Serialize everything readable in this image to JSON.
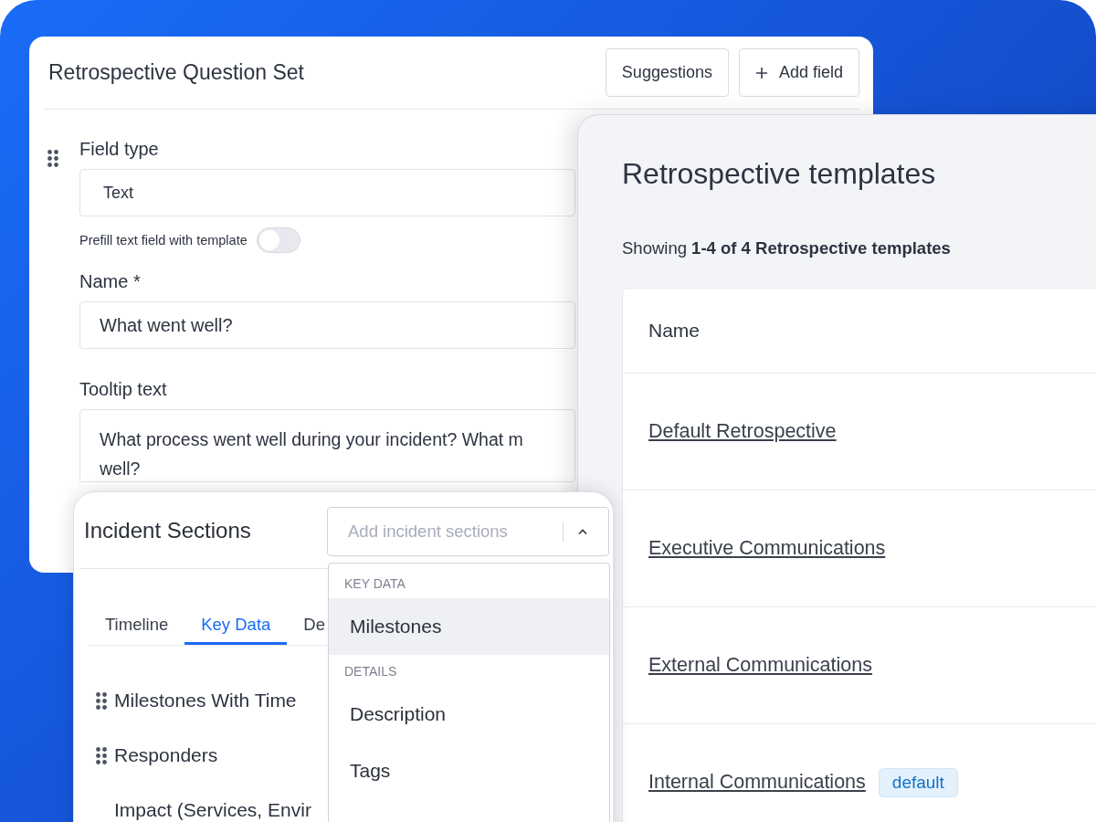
{
  "question_set": {
    "title": "Retrospective Question Set",
    "buttons": [
      {
        "label": "Suggestions",
        "kind": "plain"
      },
      {
        "label": "Add field",
        "kind": "add"
      }
    ],
    "field_type": {
      "label": "Field type",
      "value": "Text"
    },
    "prefill": {
      "label": "Prefill text field with template",
      "on": false
    },
    "name": {
      "label": "Name *",
      "value": "What went well?"
    },
    "tooltip": {
      "label": "Tooltip text",
      "lines": [
        "What process went well during your incident? What m",
        "well?"
      ]
    }
  },
  "templates": {
    "title": "Retrospective templates",
    "summary": "Showing **1-4 of 4 Retrospective templates**",
    "table": {
      "columns": [
        "Name"
      ],
      "rows": [
        {
          "name": "Default Retrospective"
        },
        {
          "name": "Executive Communications"
        },
        {
          "name": "External Communications"
        },
        {
          "name": "Internal Communications",
          "badge": "default"
        }
      ]
    }
  },
  "incident_sections": {
    "title": "Incident Sections",
    "select": {
      "placeholder": "Add incident sections",
      "expanded": true
    },
    "tabs": [
      {
        "label": "Timeline",
        "selected": false
      },
      {
        "label": "Key Data",
        "selected": true
      },
      {
        "label": "De",
        "selected": false
      }
    ],
    "sections": [
      {
        "label": "Milestones With Time",
        "draggable": true
      },
      {
        "label": "Responders",
        "draggable": true
      },
      {
        "label": "Impact (Services, Envir",
        "draggable": false
      }
    ],
    "dropdown": [
      {
        "group": "KEY DATA",
        "items": [
          {
            "label": "Milestones",
            "selected": true
          }
        ]
      },
      {
        "group": "DETAILS",
        "items": [
          {
            "label": "Description",
            "selected": false
          },
          {
            "label": "Tags",
            "selected": false
          }
        ]
      }
    ]
  }
}
